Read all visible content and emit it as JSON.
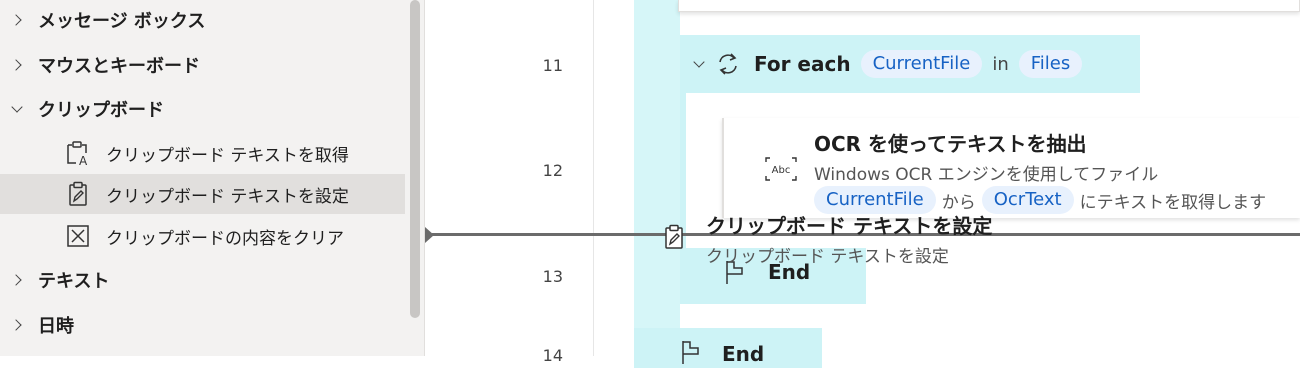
{
  "actions_pane": {
    "groups": [
      {
        "label": "メッセージ ボックス",
        "expanded": false
      },
      {
        "label": "マウスとキーボード",
        "expanded": false
      },
      {
        "label": "クリップボード",
        "expanded": true,
        "children": [
          {
            "label": "クリップボード テキストを取得",
            "icon": "clipboard-get-text-icon",
            "selected": false
          },
          {
            "label": "クリップボード テキストを設定",
            "icon": "clipboard-set-text-icon",
            "selected": true
          },
          {
            "label": "クリップボードの内容をクリア",
            "icon": "clipboard-clear-icon",
            "selected": false
          }
        ]
      },
      {
        "label": "テキスト",
        "expanded": false
      },
      {
        "label": "日時",
        "expanded": false
      }
    ]
  },
  "flow": {
    "line_numbers": [
      "11",
      "12",
      "13",
      "14"
    ],
    "foreach": {
      "keyword": "For each",
      "variable": "CurrentFile",
      "in_word": "in",
      "collection": "Files"
    },
    "ocr_step": {
      "title": "OCR を使ってテキストを抽出",
      "description": "Windows OCR エンジンを使用してファイル",
      "token1": "CurrentFile",
      "middle": "から",
      "token2": "OcrText",
      "suffix": "にテキストを取得します",
      "icon_text": "Abc"
    },
    "end_inner": "End",
    "end_outer": "End",
    "drag_ghost": {
      "title": "クリップボード テキストを設定",
      "subtitle": "クリップボード テキストを設定"
    }
  },
  "colors": {
    "loop_fill": "#cdf3f6",
    "token_bg": "#e8f1fd",
    "token_text": "#1762c4",
    "pane_bg": "#f3f2f1",
    "selected_bg": "#e1dfdd"
  }
}
